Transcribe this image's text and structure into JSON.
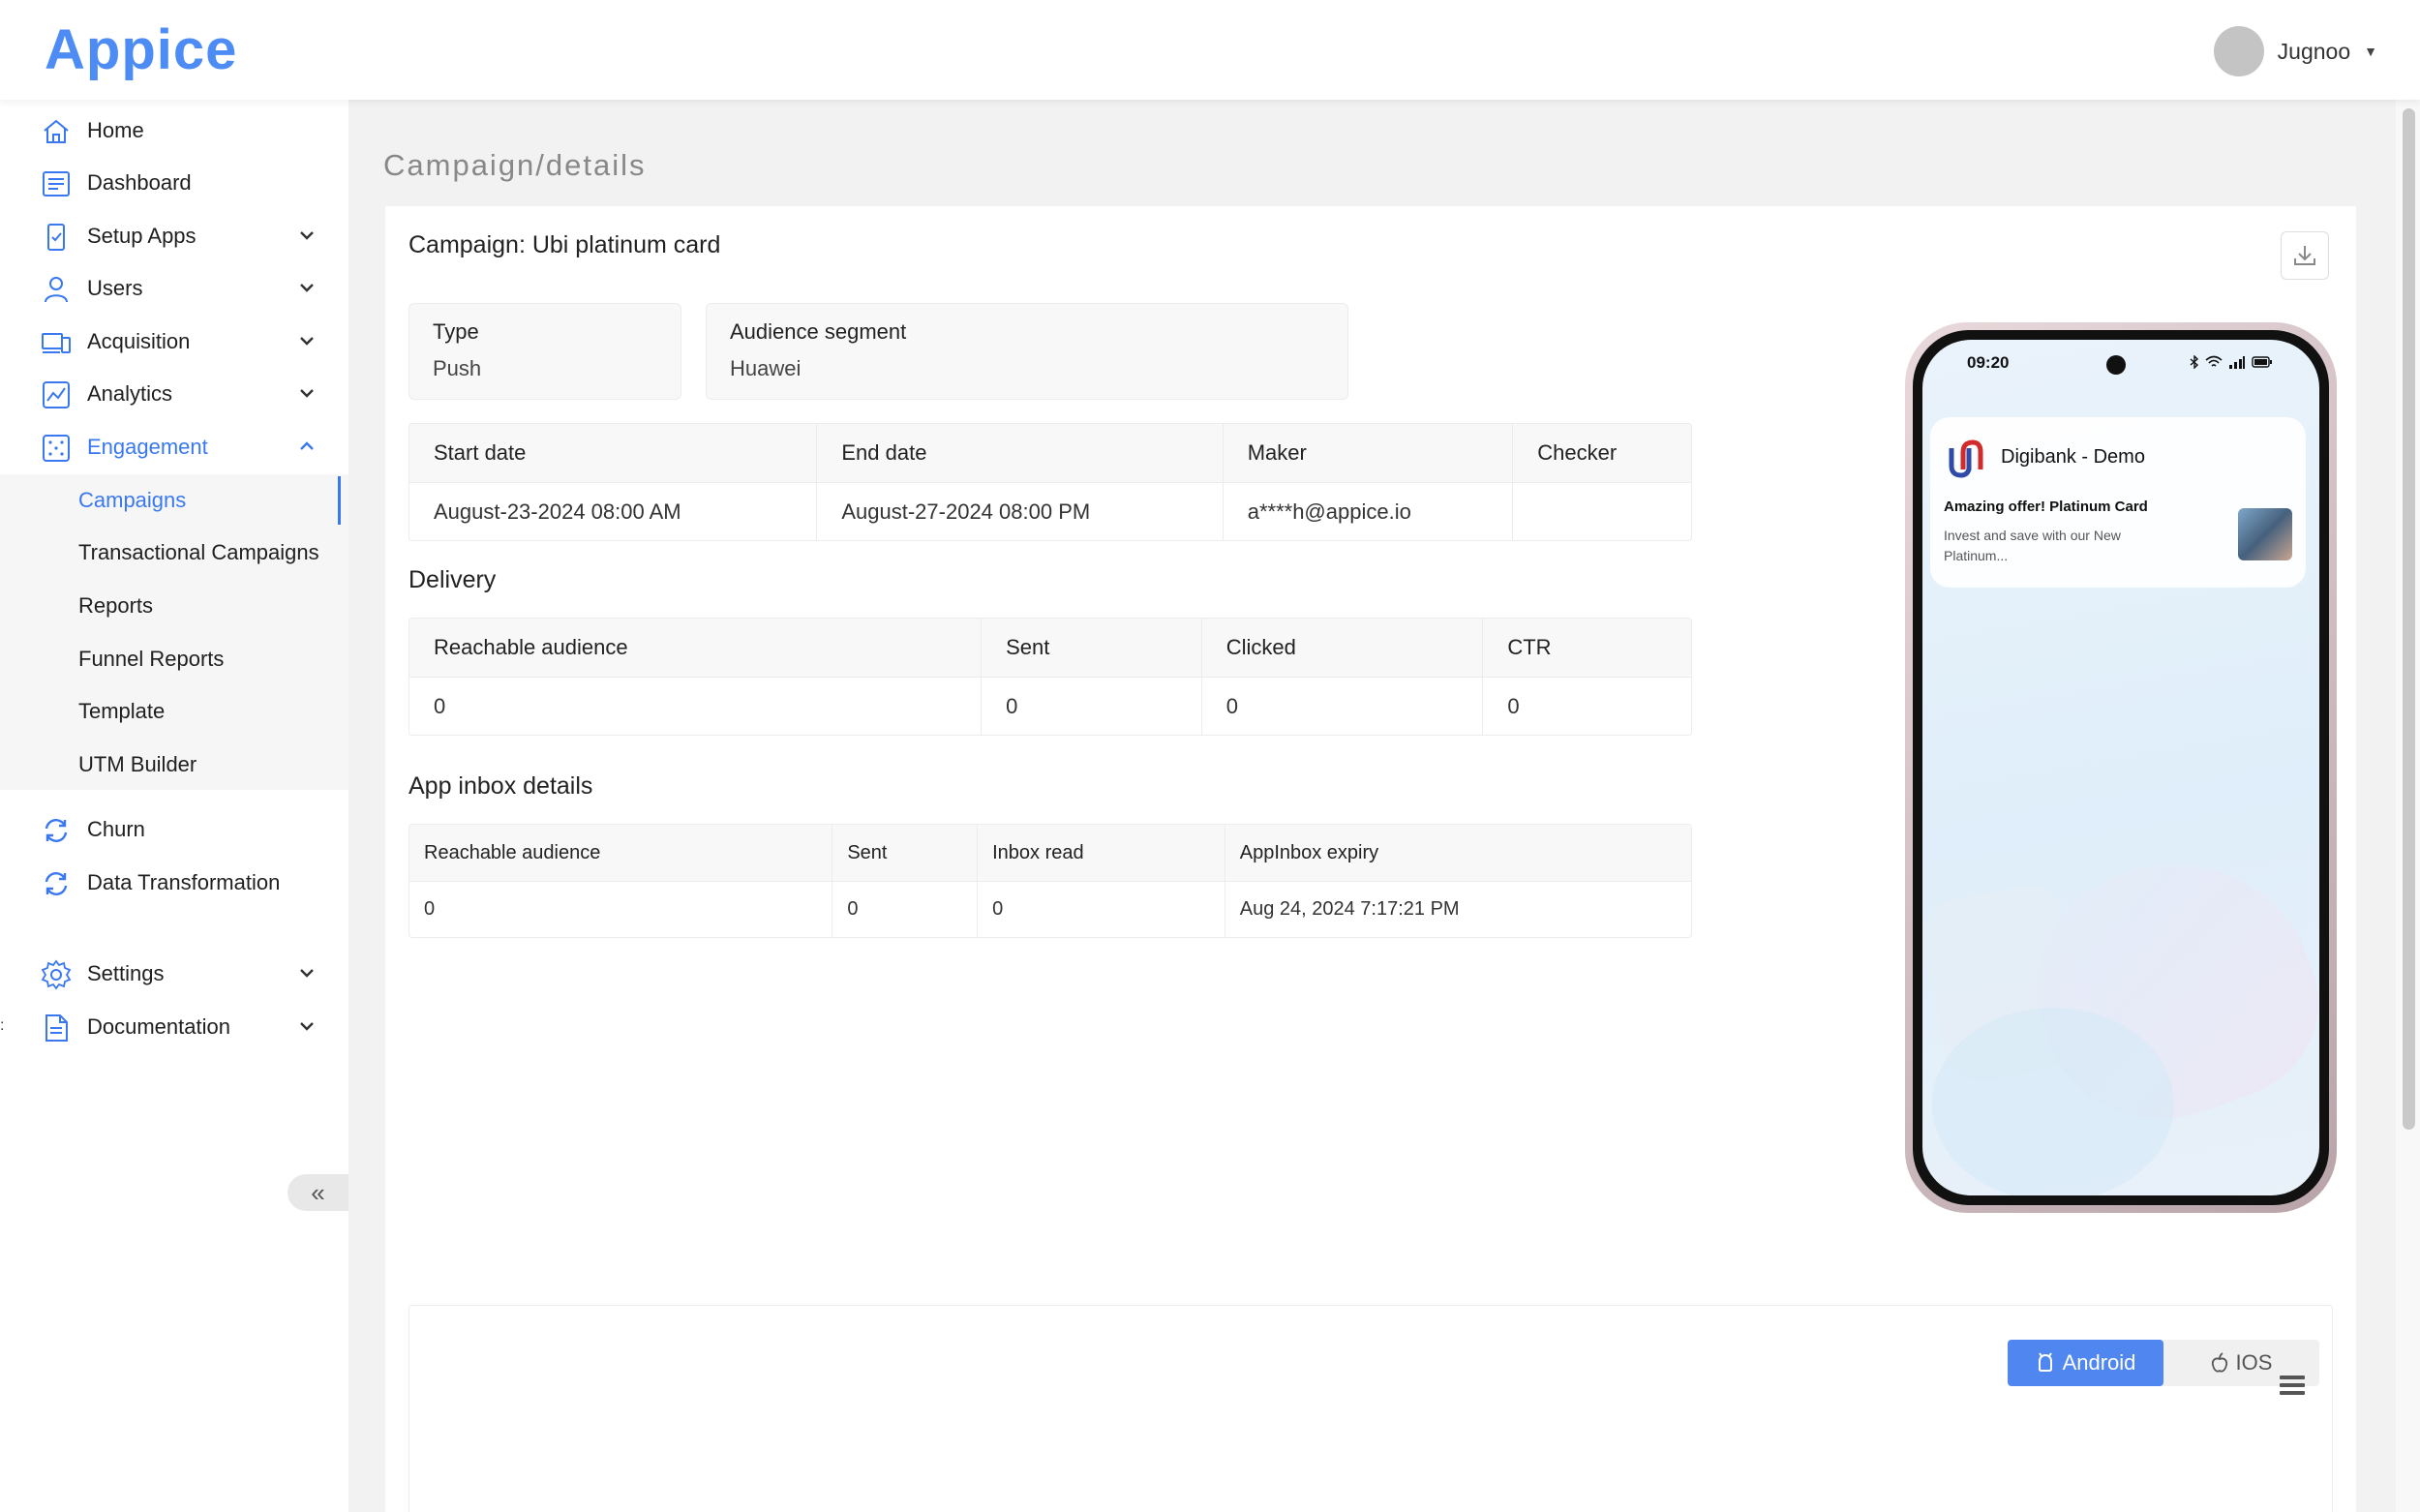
{
  "app": {
    "logo_text": "Appice"
  },
  "user": {
    "name": "Jugnoo"
  },
  "sidebar": {
    "items": [
      {
        "label": "Home"
      },
      {
        "label": "Dashboard"
      },
      {
        "label": "Setup Apps"
      },
      {
        "label": "Users"
      },
      {
        "label": "Acquisition"
      },
      {
        "label": "Analytics"
      },
      {
        "label": "Engagement"
      }
    ],
    "engagement_sub": [
      {
        "label": "Campaigns"
      },
      {
        "label": "Transactional Campaigns"
      },
      {
        "label": "Reports"
      },
      {
        "label": "Funnel Reports"
      },
      {
        "label": "Template"
      },
      {
        "label": "UTM Builder"
      }
    ],
    "items_after": [
      {
        "label": "Churn"
      },
      {
        "label": "Data Transformation"
      },
      {
        "label": "Settings"
      },
      {
        "label": "Documentation"
      }
    ],
    "collapse_glyph": "«",
    "edge_mark": ":"
  },
  "breadcrumb": "Campaign/details",
  "campaign": {
    "title": "Campaign: Ubi platinum card",
    "type_label": "Type",
    "type_value": "Push",
    "segment_label": "Audience segment",
    "segment_value": "Huawei"
  },
  "schedule_table": {
    "headers": [
      "Start date",
      "End date",
      "Maker",
      "Checker"
    ],
    "row": [
      "August-23-2024 08:00 AM",
      "August-27-2024 08:00 PM",
      "a****h@appice.io",
      ""
    ]
  },
  "delivery": {
    "heading": "Delivery",
    "headers": [
      "Reachable audience",
      "Sent",
      "Clicked",
      "CTR"
    ],
    "row": [
      "0",
      "0",
      "0",
      "0"
    ]
  },
  "app_inbox": {
    "heading": "App inbox details",
    "headers": [
      "Reachable audience",
      "Sent",
      "Inbox read",
      "AppInbox expiry"
    ],
    "row": [
      "0",
      "0",
      "0",
      "Aug 24, 2024 7:17:21 PM"
    ]
  },
  "preview": {
    "time": "09:20",
    "app_name": "Digibank - Demo",
    "notif_title": "Amazing offer! Platinum Card",
    "notif_text": "Invest and save with our New Platinum...",
    "platform_android": "Android",
    "platform_ios": "IOS",
    "selected_platform": "Android"
  },
  "colors": {
    "accent": "#3a78f2",
    "toggle_selected": "#4f86f0",
    "logo": "#4d8cf5"
  },
  "icons": [
    "home-icon",
    "dashboard-icon",
    "setup-apps-icon",
    "users-icon",
    "acquisition-icon",
    "analytics-icon",
    "engagement-icon",
    "churn-icon",
    "data-transformation-icon",
    "settings-icon",
    "documentation-icon",
    "download-icon",
    "hamburger-menu-icon",
    "android-icon",
    "apple-icon"
  ]
}
